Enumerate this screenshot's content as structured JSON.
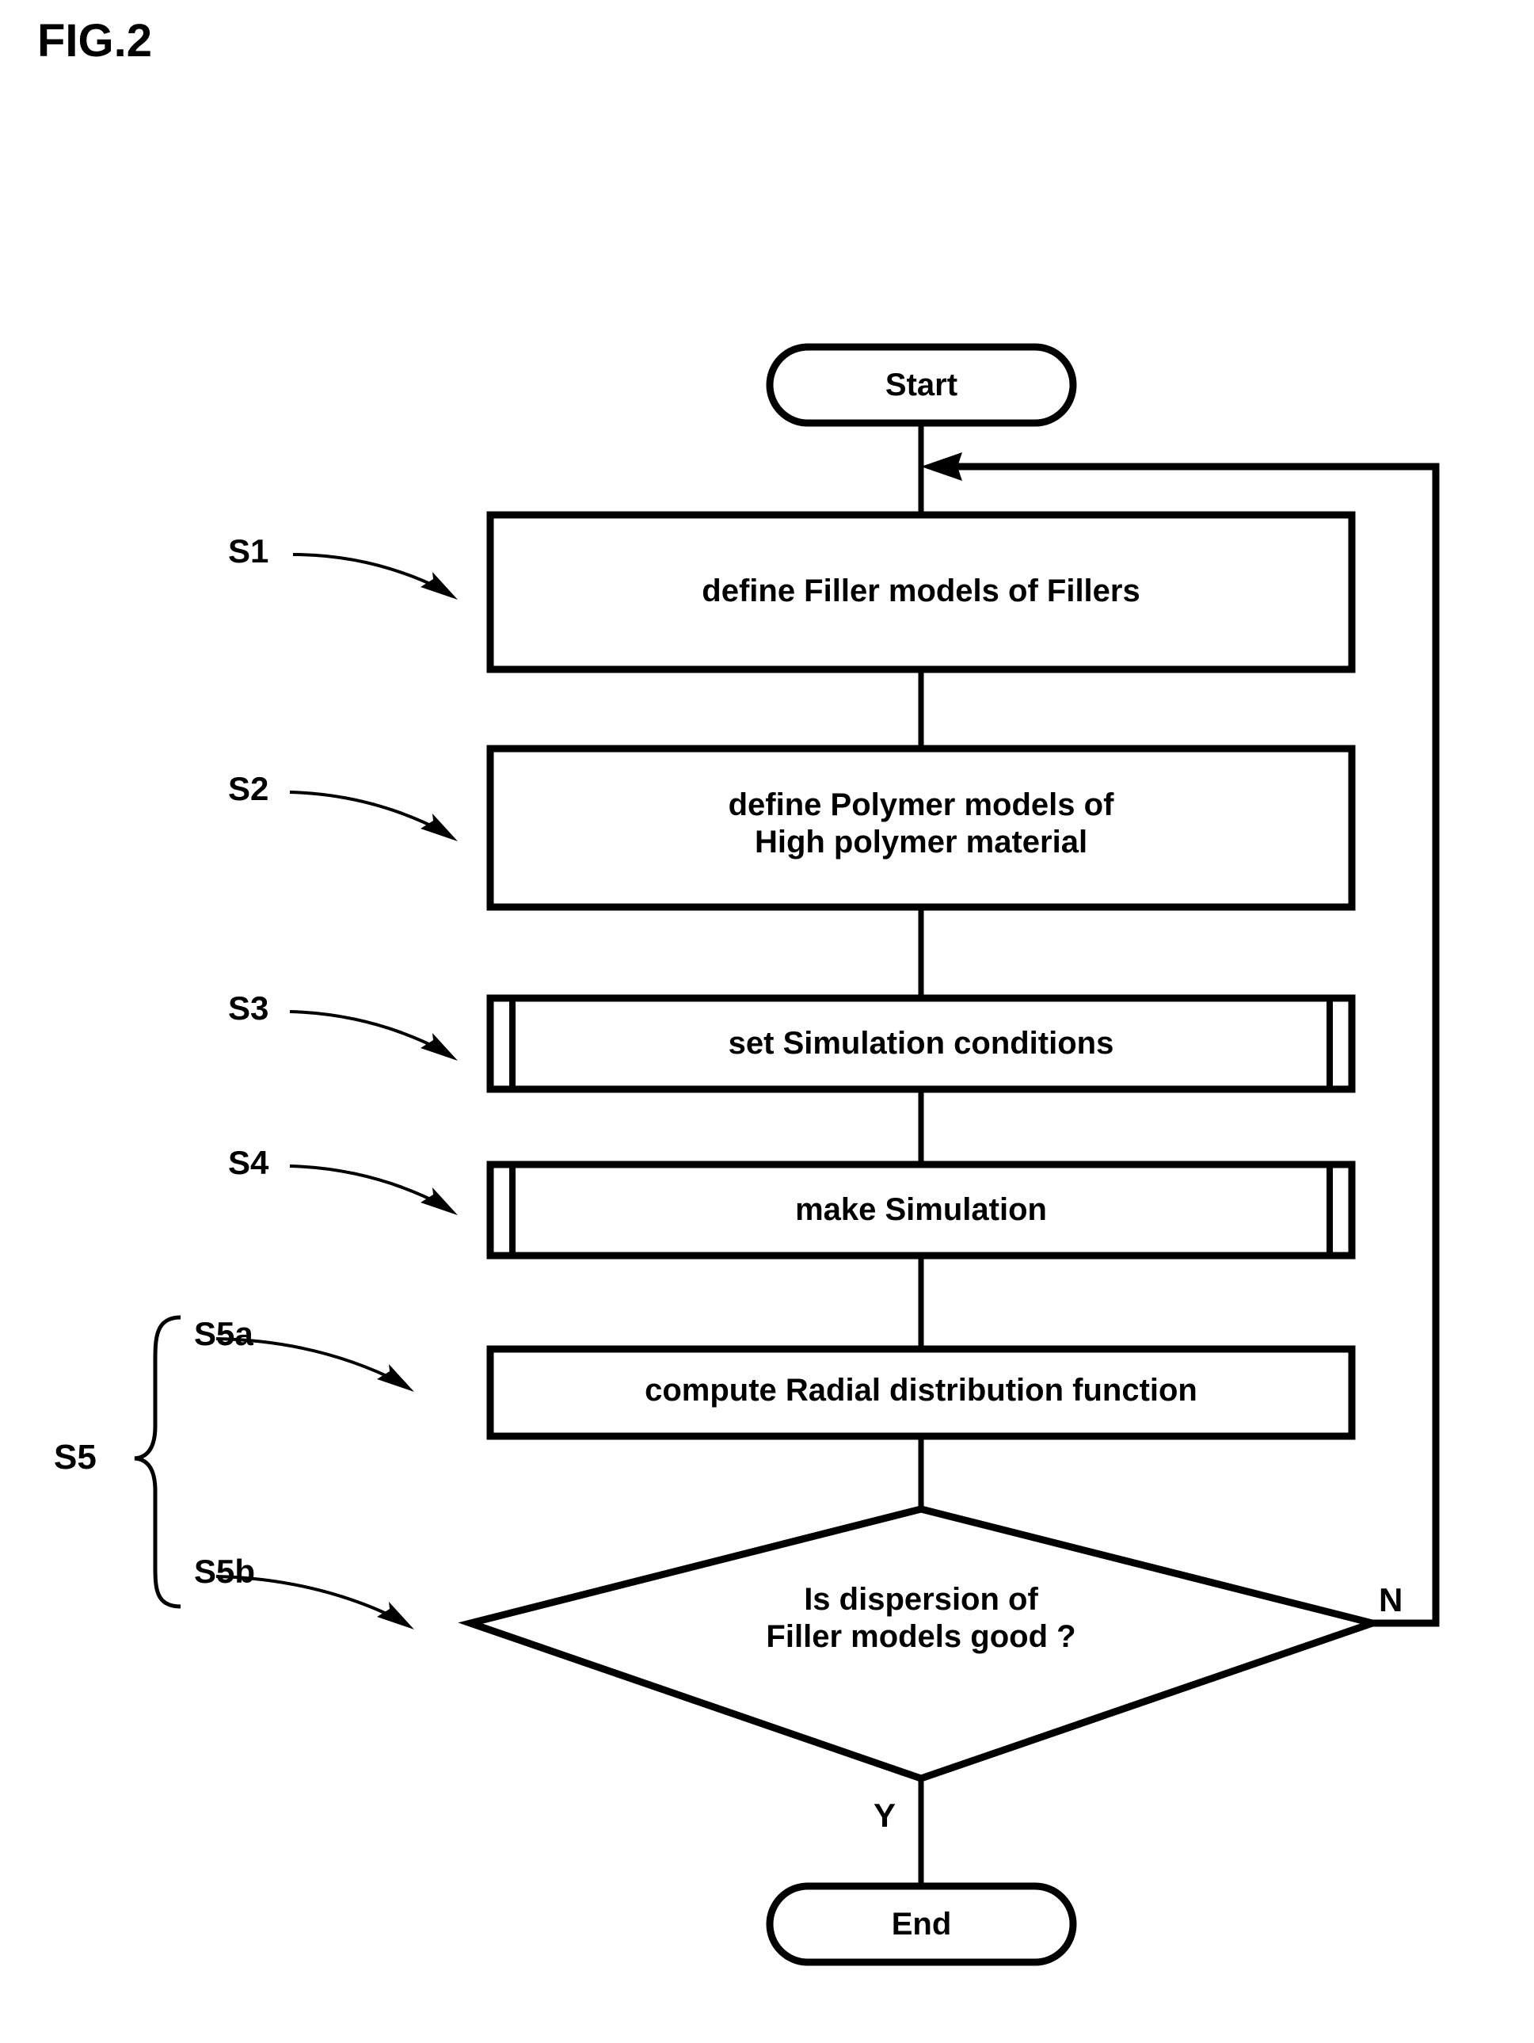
{
  "figure": {
    "title": "FIG.2"
  },
  "flowchart": {
    "nodes": [
      {
        "id": "start",
        "shape": "terminal",
        "label": "Start"
      },
      {
        "id": "s1",
        "shape": "process",
        "label": "define Filler models of Fillers",
        "step": "S1"
      },
      {
        "id": "s2",
        "shape": "process",
        "label": "define Polymer models of\nHigh polymer material",
        "step": "S2"
      },
      {
        "id": "s3",
        "shape": "predefined-process",
        "label": "set Simulation conditions",
        "step": "S3"
      },
      {
        "id": "s4",
        "shape": "predefined-process",
        "label": "make Simulation",
        "step": "S4"
      },
      {
        "id": "s5a",
        "shape": "process",
        "label": "compute Radial distribution function",
        "step": "S5a"
      },
      {
        "id": "s5b",
        "shape": "decision",
        "label": "Is dispersion of\nFiller models good ?",
        "step": "S5b"
      },
      {
        "id": "end",
        "shape": "terminal",
        "label": "End"
      }
    ],
    "group": {
      "label": "S5",
      "members": [
        "S5a",
        "S5b"
      ]
    },
    "branches": {
      "no_label": "N",
      "yes_label": "Y"
    },
    "colors": {
      "stroke": "#000000",
      "fill": "#ffffff",
      "text": "#000000"
    }
  }
}
